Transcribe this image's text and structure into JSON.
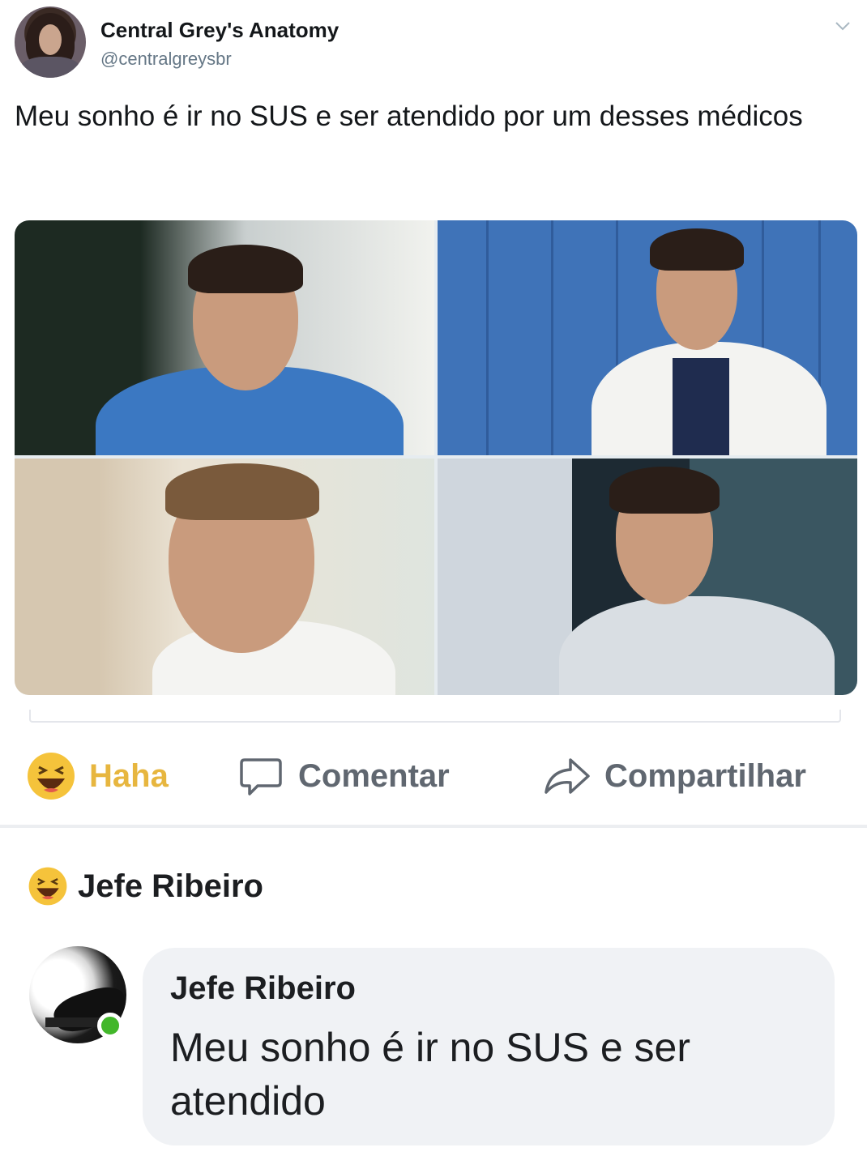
{
  "tweet": {
    "display_name": "Central Grey's Anatomy",
    "handle": "@centralgreysbr",
    "text": "Meu sonho é ir no SUS e ser atendido por um desses médicos"
  },
  "actions": {
    "haha_label": "Haha",
    "comment_label": "Comentar",
    "share_label": "Compartilhar"
  },
  "reaction": {
    "reactor_name": "Jefe Ribeiro"
  },
  "comment": {
    "author": "Jefe Ribeiro",
    "text": "Meu sonho é ir no SUS e ser atendido"
  },
  "colors": {
    "haha_yellow": "#e7b63f",
    "online_green": "#42b72a",
    "bubble_bg": "#f0f2f5"
  }
}
